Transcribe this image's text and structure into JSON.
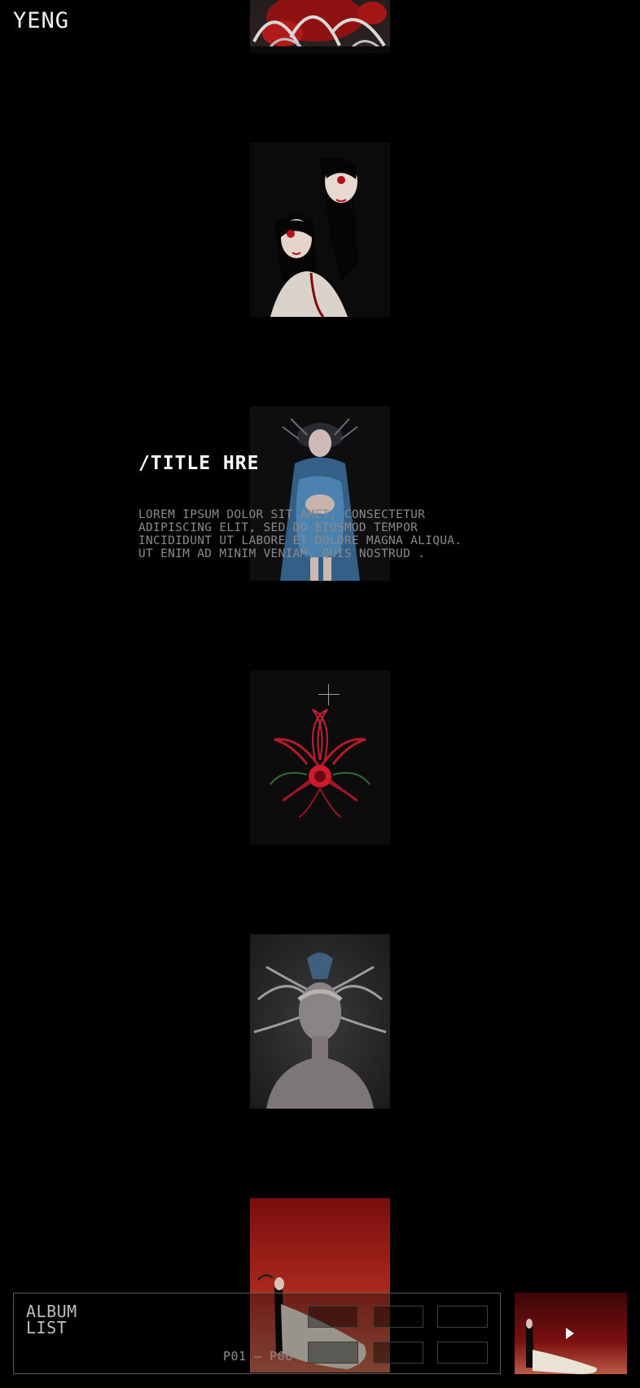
{
  "header": {
    "logo": "YENG"
  },
  "gallery": {
    "items": [
      {
        "name": "album-cover-1",
        "theme": "red-silver-sculpture"
      },
      {
        "name": "album-cover-2",
        "theme": "twins-dark-hair"
      },
      {
        "name": "album-cover-3",
        "theme": "blue-dress"
      },
      {
        "name": "album-cover-4",
        "theme": "red-insect-emblem"
      },
      {
        "name": "album-cover-5",
        "theme": "grey-bust"
      },
      {
        "name": "album-cover-6",
        "theme": "red-gradient-figure"
      }
    ]
  },
  "feature": {
    "title": "/TITLE HRE",
    "body": "LOREM IPSUM DOLOR SIT AMET, CONSECTETUR\nADIPISCING ELIT, SED DO EIUSMOD TEMPOR\nINCIDIDUNT UT LABORE ET DOLORE MAGNA ALIQUA.\nUT ENIM AD MINIM VENIAM, QUIS NOSTRUD ."
  },
  "album_list": {
    "title_line1": "ALBUM",
    "title_line2": "LIST",
    "page_range": "P01 — P06"
  },
  "player": {
    "icon": "play-icon"
  },
  "colors": {
    "background": "#000000",
    "accent_red": "#8b1010",
    "text_muted": "#8a8a8a"
  }
}
